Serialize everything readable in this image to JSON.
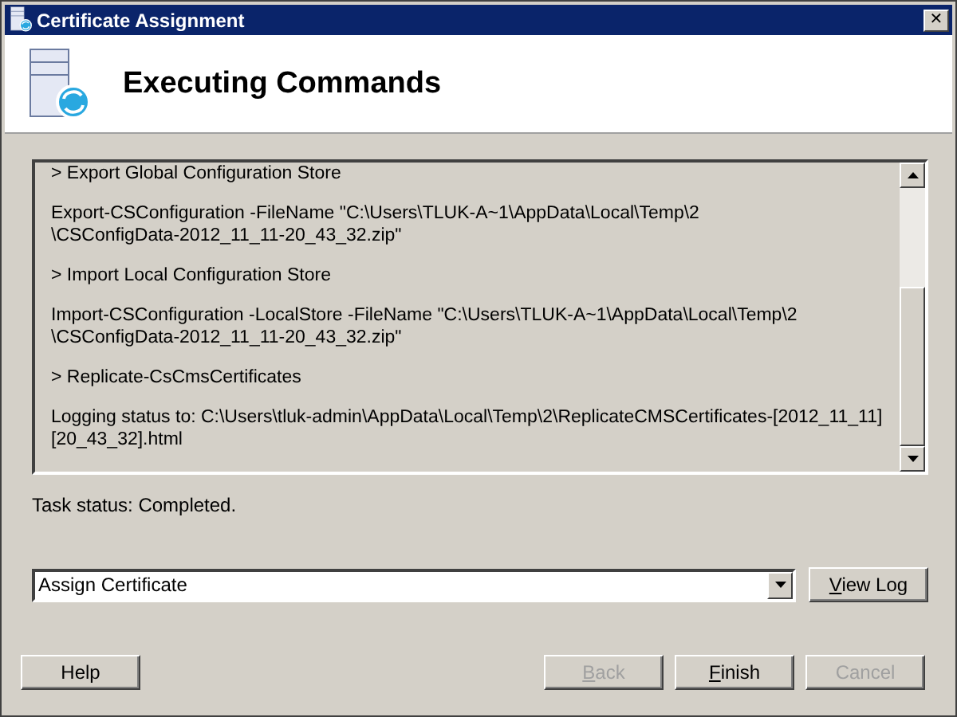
{
  "window": {
    "title": "Certificate Assignment",
    "close": "✕"
  },
  "header": {
    "title": "Executing Commands"
  },
  "log": {
    "paragraphs": [
      "> Export Global Configuration Store",
      "Export-CSConfiguration -FileName \"C:\\Users\\TLUK-A~1\\AppData\\Local\\Temp\\2\n\\CSConfigData-2012_11_11-20_43_32.zip\"",
      "> Import Local Configuration Store",
      "Import-CSConfiguration -LocalStore -FileName \"C:\\Users\\TLUK-A~1\\AppData\\Local\\Temp\\2\n\\CSConfigData-2012_11_11-20_43_32.zip\"",
      "> Replicate-CsCmsCertificates",
      "Logging status to: C:\\Users\\tluk-admin\\AppData\\Local\\Temp\\2\\ReplicateCMSCertificates-[2012_11_11]\n[20_43_32].html"
    ]
  },
  "status": "Task status: Completed.",
  "task_select": {
    "value": "Assign Certificate"
  },
  "view_log": {
    "label": "View Log",
    "mnemonic": true,
    "disabled": false
  },
  "buttons": [
    {
      "label": "Help",
      "mnemonic": false,
      "disabled": false
    },
    {
      "label": "Back",
      "mnemonic": true,
      "disabled": true
    },
    {
      "label": "Finish",
      "mnemonic": true,
      "disabled": false
    },
    {
      "label": "Cancel",
      "mnemonic": false,
      "disabled": true
    }
  ]
}
